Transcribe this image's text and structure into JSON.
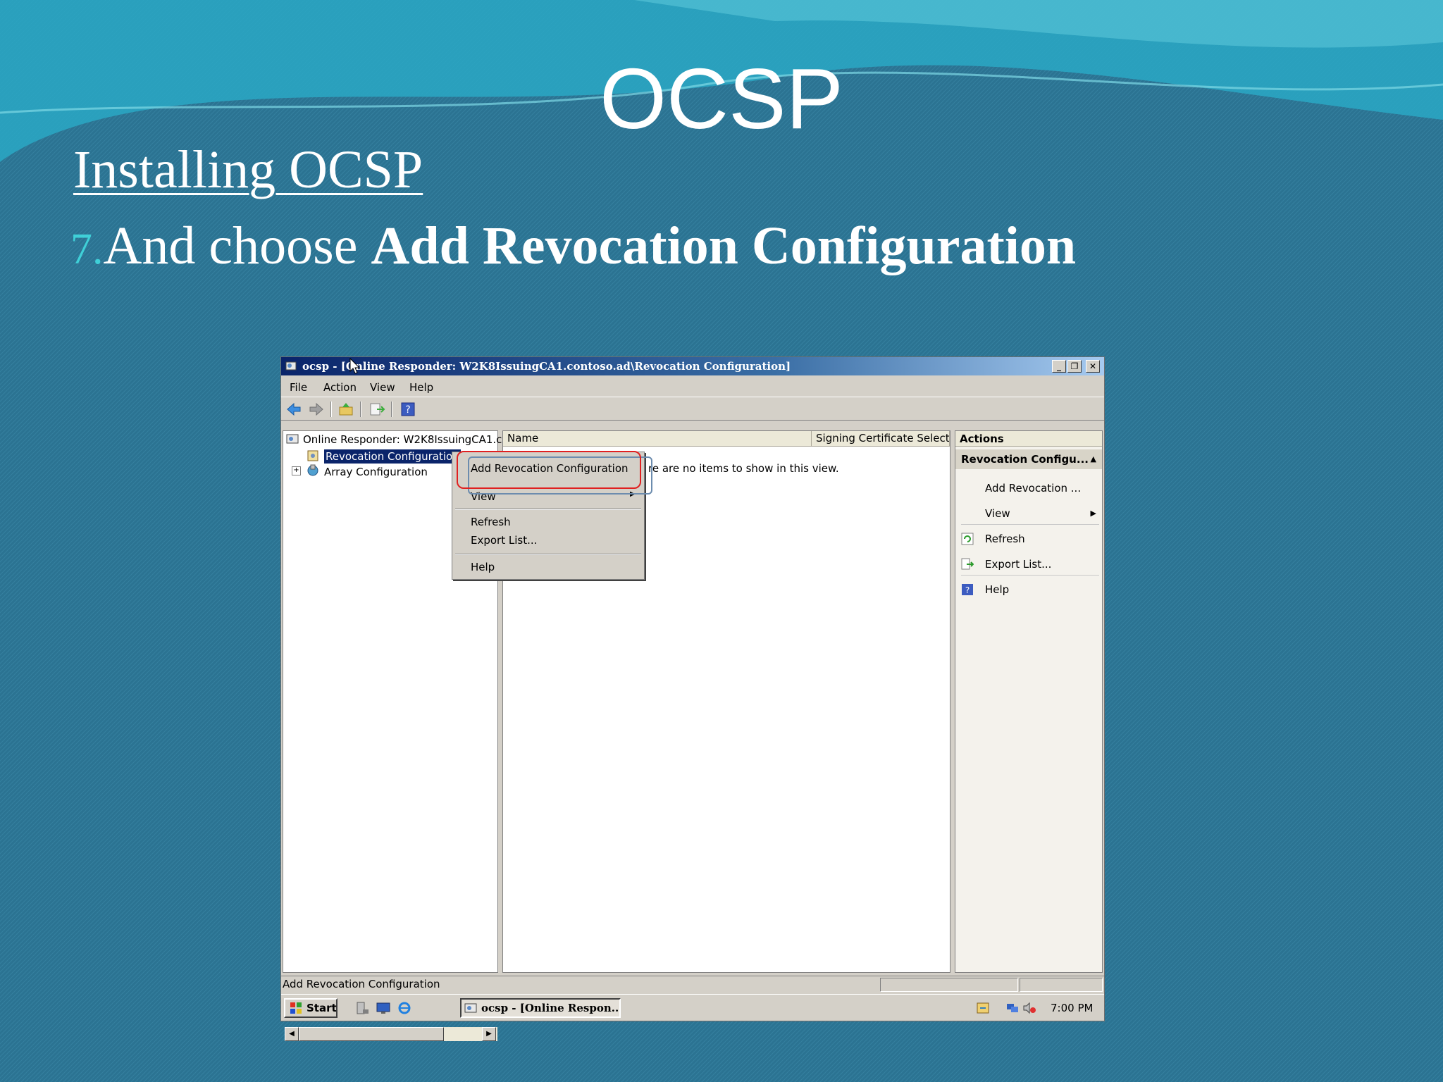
{
  "slide": {
    "title": "OCSP",
    "subtitle": "Installing OCSP",
    "step_number": "7.",
    "step_text": "And choose ",
    "step_bold": "Add Revocation Configuration"
  },
  "window": {
    "title": "ocsp - [Online Responder: W2K8IssuingCA1.contoso.ad\\Revocation Configuration]",
    "menu": [
      "File",
      "Action",
      "View",
      "Help"
    ]
  },
  "tree": {
    "root": "Online Responder: W2K8IssuingCA1.c",
    "selected": "Revocation Configuration",
    "array": "Array Configuration"
  },
  "list": {
    "col_name": "Name",
    "col_signing": "Signing Certificate Selectic",
    "empty": "re are no items to show in this view."
  },
  "context_menu": {
    "add": "Add Revocation Configuration",
    "view": "View",
    "refresh": "Refresh",
    "export": "Export List...",
    "help": "Help"
  },
  "actions": {
    "header": "Actions",
    "section": "Revocation Configu...",
    "add": "Add Revocation ...",
    "view": "View",
    "refresh": "Refresh",
    "export": "Export List...",
    "help": "Help"
  },
  "status": "Add Revocation Configuration",
  "taskbar": {
    "start": "Start",
    "task": "ocsp - [Online Respon...",
    "clock": "7:00 PM"
  },
  "icons": [
    "snapin-icon",
    "back-icon",
    "forward-icon",
    "up-folder-icon",
    "export-icon",
    "help-icon",
    "refresh-icon",
    "ie-icon"
  ]
}
